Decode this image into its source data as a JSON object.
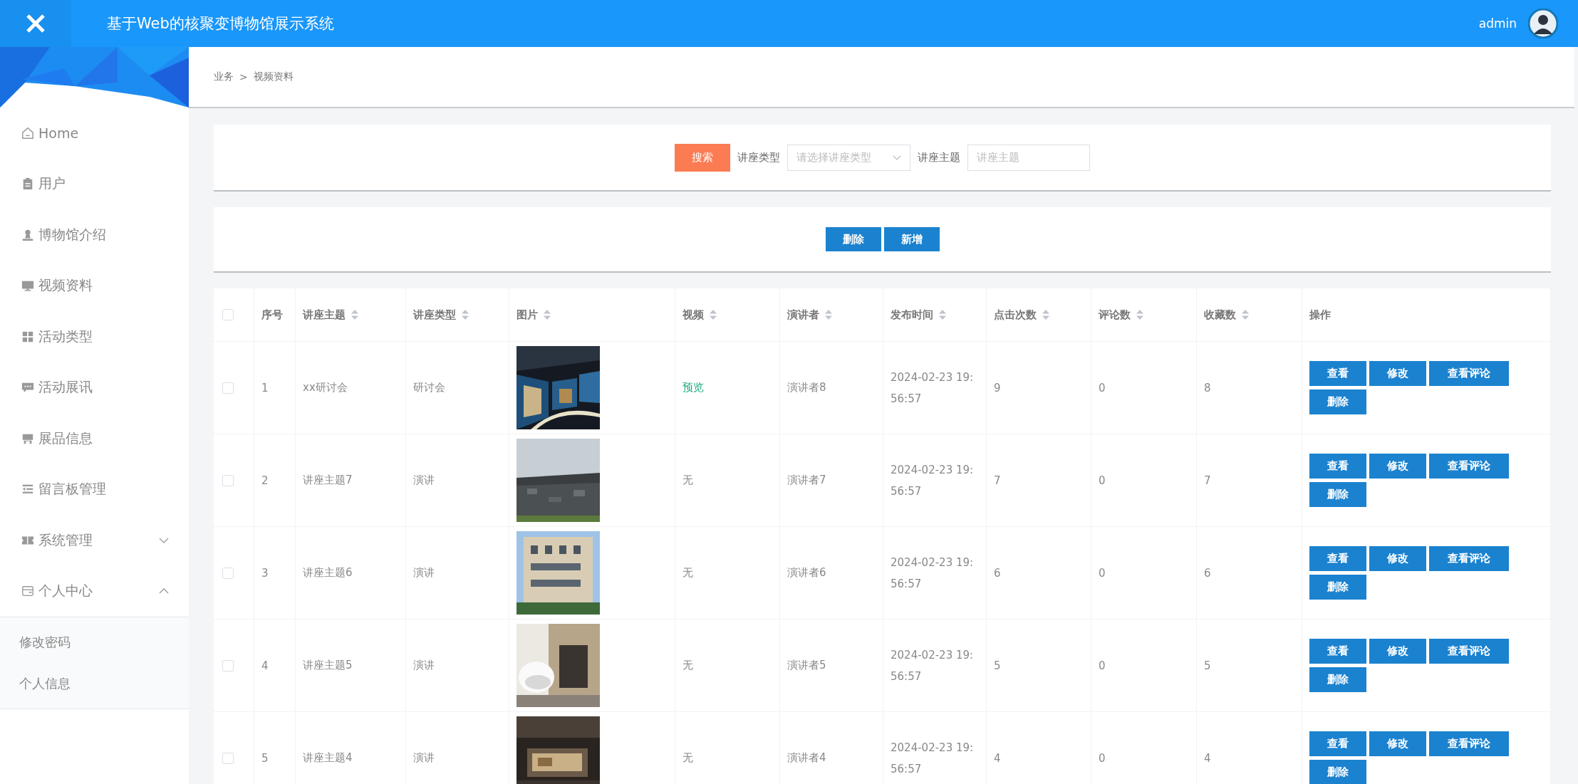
{
  "header": {
    "title": "基于Web的核聚变博物馆展示系统",
    "user": "admin"
  },
  "sidebar": {
    "items": [
      {
        "label": "Home"
      },
      {
        "label": "用户"
      },
      {
        "label": "博物馆介绍"
      },
      {
        "label": "视频资料"
      },
      {
        "label": "活动类型"
      },
      {
        "label": "活动展讯"
      },
      {
        "label": "展品信息"
      },
      {
        "label": "留言板管理"
      },
      {
        "label": "系统管理",
        "expanded": false
      },
      {
        "label": "个人中心",
        "expanded": true,
        "children": [
          {
            "label": "修改密码"
          },
          {
            "label": "个人信息"
          }
        ]
      }
    ]
  },
  "breadcrumb": [
    "业务",
    ">",
    "视频资料"
  ],
  "search": {
    "button": "搜索",
    "type_label": "讲座类型",
    "type_placeholder": "请选择讲座类型",
    "topic_label": "讲座主题",
    "topic_placeholder": "讲座主题"
  },
  "toolbar": [
    "删除",
    "新增"
  ],
  "table": {
    "all_checked": false,
    "columns": [
      {
        "label": "序号",
        "sortable": false
      },
      {
        "label": "讲座主题",
        "sortable": true
      },
      {
        "label": "讲座类型",
        "sortable": true
      },
      {
        "label": "图片",
        "sortable": true
      },
      {
        "label": "视频",
        "sortable": true
      },
      {
        "label": "演讲者",
        "sortable": true
      },
      {
        "label": "发布时间",
        "sortable": true
      },
      {
        "label": "点击次数",
        "sortable": true
      },
      {
        "label": "评论数",
        "sortable": true
      },
      {
        "label": "收藏数",
        "sortable": true
      },
      {
        "label": "操作",
        "sortable": false
      }
    ],
    "rows": [
      {
        "checked": false,
        "cells": [
          "1",
          "xx研讨会",
          "研讨会"
        ],
        "picture": {
          "kind": "picture"
        },
        "video": {
          "text": "预览",
          "kind": "link"
        },
        "speaker": "演讲者8",
        "time": "2024-02-23 19:56:57",
        "counts": [
          "9",
          "0",
          "8"
        ],
        "actions": [
          "查看",
          "修改",
          "查看评论",
          "删除"
        ]
      },
      {
        "checked": false,
        "cells": [
          "2",
          "讲座主题7",
          "演讲"
        ],
        "picture": {
          "kind": "picture"
        },
        "video": {
          "text": "无",
          "kind": "text"
        },
        "speaker": "演讲者7",
        "time": "2024-02-23 19:56:57",
        "counts": [
          "7",
          "0",
          "7"
        ],
        "actions": [
          "查看",
          "修改",
          "查看评论",
          "删除"
        ]
      },
      {
        "checked": false,
        "cells": [
          "3",
          "讲座主题6",
          "演讲"
        ],
        "picture": {
          "kind": "picture"
        },
        "video": {
          "text": "无",
          "kind": "text"
        },
        "speaker": "演讲者6",
        "time": "2024-02-23 19:56:57",
        "counts": [
          "6",
          "0",
          "6"
        ],
        "actions": [
          "查看",
          "修改",
          "查看评论",
          "删除"
        ]
      },
      {
        "checked": false,
        "cells": [
          "4",
          "讲座主题5",
          "演讲"
        ],
        "picture": {
          "kind": "picture"
        },
        "video": {
          "text": "无",
          "kind": "text"
        },
        "speaker": "演讲者5",
        "time": "2024-02-23 19:56:57",
        "counts": [
          "5",
          "0",
          "5"
        ],
        "actions": [
          "查看",
          "修改",
          "查看评论",
          "删除"
        ]
      },
      {
        "checked": false,
        "cells": [
          "5",
          "讲座主题4",
          "演讲"
        ],
        "picture": {
          "kind": "picture"
        },
        "video": {
          "text": "无",
          "kind": "text"
        },
        "speaker": "演讲者4",
        "time": "2024-02-23 19:56:57",
        "counts": [
          "4",
          "0",
          "4"
        ],
        "actions": [
          "查看",
          "修改",
          "查看评论",
          "删除"
        ]
      }
    ]
  }
}
